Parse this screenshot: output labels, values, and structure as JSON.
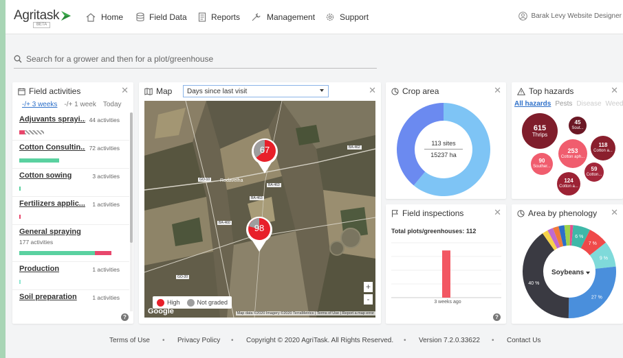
{
  "app": {
    "logo_text": "Agritask",
    "logo_badge": "BETA",
    "nav": [
      {
        "label": "Home",
        "icon": "home-icon"
      },
      {
        "label": "Field Data",
        "icon": "database-icon"
      },
      {
        "label": "Reports",
        "icon": "report-icon"
      },
      {
        "label": "Management",
        "icon": "tools-icon"
      },
      {
        "label": "Support",
        "icon": "gear-icon"
      }
    ],
    "user": "Barak Levy Website Designer"
  },
  "search": {
    "placeholder": "Search for a grower and then for a plot/greenhouse"
  },
  "field_activities": {
    "title": "Field activities",
    "ranges": [
      "-/+ 3 weeks",
      "-/+ 1 week",
      "Today"
    ],
    "items": [
      {
        "name": "Adjuvants sprayi...",
        "count": "44 activities"
      },
      {
        "name": "Cotton Consultin...",
        "count": "72 activities"
      },
      {
        "name": "Cotton sowing",
        "count": "3 activities"
      },
      {
        "name": "Fertilizers applic...",
        "count": "1 activities"
      },
      {
        "name": "General spraying",
        "count": "177 activities"
      },
      {
        "name": "Production",
        "count": "1 activities"
      },
      {
        "name": "Soil preparation",
        "count": "1 activities"
      }
    ],
    "help": "?"
  },
  "map": {
    "title": "Map",
    "select_value": "Days since last visit",
    "markers": [
      {
        "value": "67"
      },
      {
        "value": "98"
      }
    ],
    "place_label": "Rodavelha",
    "road_labels": [
      "BA-463",
      "BA-463",
      "BA-462",
      "GO-10",
      "BA-460",
      "GO-20"
    ],
    "legend": [
      {
        "label": "High",
        "color": "#e8202a"
      },
      {
        "label": "Not graded",
        "color": "#9e9e9e"
      }
    ],
    "zoom_in": "+",
    "zoom_out": "-",
    "google": "Google",
    "attribution": "Map data ©2020 Imagery ©2020 TerraMetrics | Terms of Use | Report a map error"
  },
  "crop_area": {
    "title": "Crop area",
    "sites": "113 sites",
    "hectares": "15237 ha",
    "segments": [
      {
        "value": 0.61,
        "color": "#7ec4f5"
      },
      {
        "value": 0.39,
        "color": "#6b8af0"
      }
    ]
  },
  "field_inspections": {
    "title": "Field inspections",
    "total_label": "Total plots/greenhouses: 112",
    "bar_fraction": 0.86,
    "bar_color": "#f25763",
    "x_label": "3 weeks ago",
    "help": "?"
  },
  "top_hazards": {
    "title": "Top hazards",
    "tabs": [
      "All hazards",
      "Pests",
      "Disease",
      "Weeds"
    ],
    "bubbles": [
      {
        "value": "615",
        "label": "Thrips",
        "color": "#7f1d2b"
      },
      {
        "value": "45",
        "label": "Sout...",
        "color": "#6b1825"
      },
      {
        "value": "253",
        "label": "Cotton aph...",
        "color": "#f05d6e"
      },
      {
        "value": "118",
        "label": "Cotton a...",
        "color": "#8a1f2d"
      },
      {
        "value": "90",
        "label": "Souther...",
        "color": "#f05d6e"
      },
      {
        "value": "59",
        "label": "Cotton...",
        "color": "#a3263a"
      },
      {
        "value": "124",
        "label": "Cotton a...",
        "color": "#9c2234"
      }
    ]
  },
  "phenology": {
    "title": "Area by phenology",
    "selected": "Soybeans",
    "segments": [
      {
        "pct": 0.06,
        "label": "6 %",
        "color": "#3fb8a8"
      },
      {
        "pct": 0.07,
        "label": "7 %",
        "color": "#ef4a4a"
      },
      {
        "pct": 0.09,
        "label": "9 %",
        "color": "#7fdada"
      },
      {
        "pct": 0.27,
        "label": "27 %",
        "color": "#4a8fdc"
      },
      {
        "pct": 0.4,
        "label": "40 %",
        "color": "#3a3a42"
      },
      {
        "pct": 0.02,
        "label": "",
        "color": "#f6d34a"
      },
      {
        "pct": 0.02,
        "label": "",
        "color": "#c06ad0"
      },
      {
        "pct": 0.02,
        "label": "",
        "color": "#f07a3a"
      },
      {
        "pct": 0.02,
        "label": "",
        "color": "#2c6fc9"
      },
      {
        "pct": 0.02,
        "label": "",
        "color": "#9ed24a"
      },
      {
        "pct": 0.01,
        "label": "",
        "color": "#e44f8e"
      }
    ]
  },
  "footer": {
    "terms": "Terms of Use",
    "privacy": "Privacy Policy",
    "copyright": "Copyright © 2020 AgriTask. All Rights Reserved.",
    "version": "Version 7.2.0.33622",
    "contact": "Contact Us",
    "separator": "•"
  }
}
